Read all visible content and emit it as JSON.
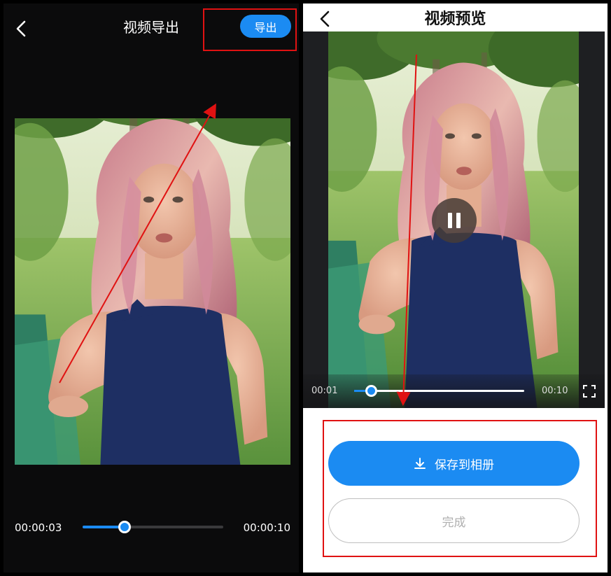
{
  "left_screen": {
    "title": "视频导出",
    "export_button": "导出",
    "current_time": "00:00:03",
    "total_time": "00:00:10",
    "progress": 0.3,
    "back_icon": "chevron-left-icon"
  },
  "right_screen": {
    "title": "视频预览",
    "current_time": "00:01",
    "total_time": "00:10",
    "progress": 0.1,
    "save_button": "保存到相册",
    "done_button": "完成",
    "back_icon": "chevron-left-icon",
    "pause_icon": "pause-icon",
    "fullscreen_icon": "fullscreen-icon",
    "download_icon": "download-icon"
  },
  "colors": {
    "accent": "#1b8bf2",
    "annotation_red": "#e01212",
    "dark_bg": "#0b0b0c"
  }
}
